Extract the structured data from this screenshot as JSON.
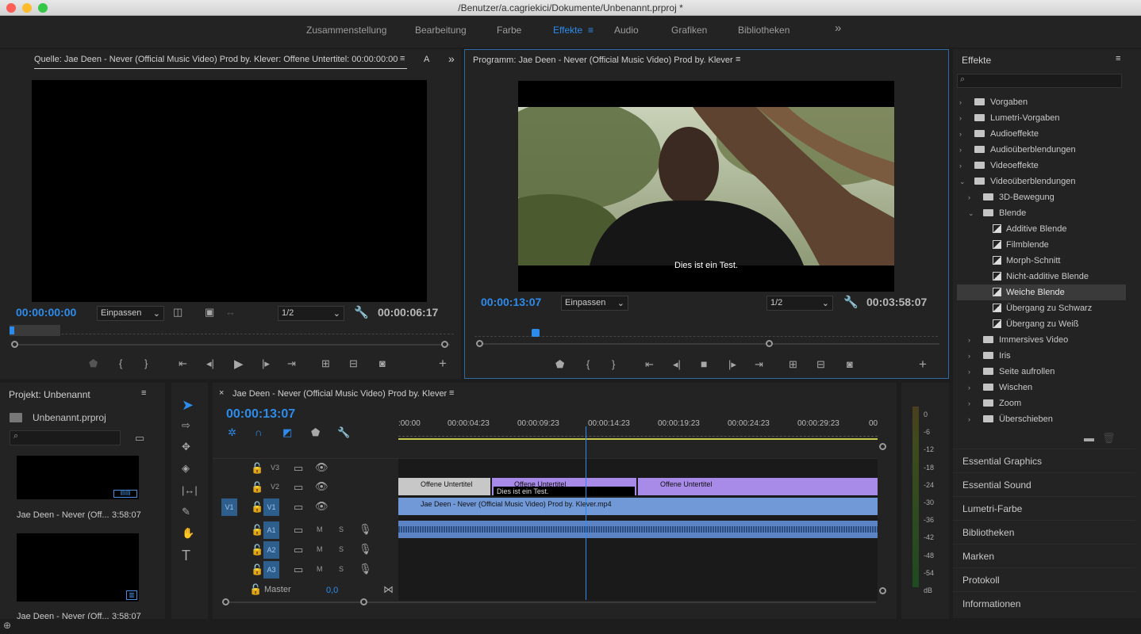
{
  "window": {
    "title": "/Benutzer/a.cagriekici/Dokumente/Unbenannt.prproj *"
  },
  "workspaces": {
    "items": [
      "Zusammenstellung",
      "Bearbeitung",
      "Farbe",
      "Effekte",
      "Audio",
      "Grafiken",
      "Bibliotheken"
    ],
    "active": "Effekte",
    "overflow": "»"
  },
  "source": {
    "title": "Quelle: Jae Deen - Never (Official Music Video) Prod by. Klever: Offene Untertitel: 00:00:00:00",
    "menu": "≡",
    "tab2": "A",
    "timecode": "00:00:00:00",
    "fit": "Einpassen",
    "res": "1/2",
    "duration": "00:00:06:17"
  },
  "program": {
    "title": "Programm: Jae Deen - Never (Official Music Video) Prod by. Klever",
    "menu": "≡",
    "timecode": "00:00:13:07",
    "fit": "Einpassen",
    "res": "1/2",
    "duration": "00:03:58:07",
    "subtitle": "Dies ist ein Test."
  },
  "project": {
    "title": "Projekt: Unbenannt",
    "file": "Unbenannt.prproj",
    "clip1_name": "Jae Deen - Never (Off...",
    "clip1_dur": "3:58:07",
    "clip2_name": "Jae Deen - Never (Off...",
    "clip2_dur": "3:58:07"
  },
  "timeline": {
    "title": "Jae Deen - Never (Official Music Video) Prod by. Klever",
    "close": "×",
    "timecode": "00:00:13:07",
    "ruler": [
      ":00:00",
      "00:00:04:23",
      "00:00:09:23",
      "00:00:14:23",
      "00:00:19:23",
      "00:00:24:23",
      "00:00:29:23",
      "00"
    ],
    "tracks": {
      "v3": "V3",
      "v2": "V2",
      "v1": "V1",
      "src_v1": "V1",
      "a1": "A1",
      "a2": "A2",
      "a3": "A3",
      "master": "Master",
      "master_val": "0,0",
      "m": "M",
      "s": "S"
    },
    "caption_label": "Offene Untertitel",
    "caption_tip": "Dies ist ein Test.",
    "video_clip": "Jae Deen - Never (Official Music Video) Prod by. Klever.mp4",
    "playhead_fraction": 0.39
  },
  "effects": {
    "title": "Effekte",
    "menu": "≡",
    "search_placeholder": "",
    "tree": [
      {
        "label": "Vorgaben",
        "level": 0,
        "kind": "preset-folder",
        "open": false
      },
      {
        "label": "Lumetri-Vorgaben",
        "level": 0,
        "kind": "preset-folder",
        "open": false
      },
      {
        "label": "Audioeffekte",
        "level": 0,
        "kind": "folder",
        "open": false
      },
      {
        "label": "Audioüberblendungen",
        "level": 0,
        "kind": "folder",
        "open": false
      },
      {
        "label": "Videoeffekte",
        "level": 0,
        "kind": "folder",
        "open": false
      },
      {
        "label": "Videoüberblendungen",
        "level": 0,
        "kind": "folder",
        "open": true
      },
      {
        "label": "3D-Bewegung",
        "level": 1,
        "kind": "folder",
        "open": false
      },
      {
        "label": "Blende",
        "level": 1,
        "kind": "folder",
        "open": true
      },
      {
        "label": "Additive Blende",
        "level": 2,
        "kind": "effect"
      },
      {
        "label": "Filmblende",
        "level": 2,
        "kind": "effect"
      },
      {
        "label": "Morph-Schnitt",
        "level": 2,
        "kind": "effect"
      },
      {
        "label": "Nicht-additive Blende",
        "level": 2,
        "kind": "effect"
      },
      {
        "label": "Weiche Blende",
        "level": 2,
        "kind": "effect",
        "selected": true
      },
      {
        "label": "Übergang zu Schwarz",
        "level": 2,
        "kind": "effect"
      },
      {
        "label": "Übergang zu Weiß",
        "level": 2,
        "kind": "effect"
      },
      {
        "label": "Immersives Video",
        "level": 1,
        "kind": "folder",
        "open": false
      },
      {
        "label": "Iris",
        "level": 1,
        "kind": "folder",
        "open": false
      },
      {
        "label": "Seite aufrollen",
        "level": 1,
        "kind": "folder",
        "open": false
      },
      {
        "label": "Wischen",
        "level": 1,
        "kind": "folder",
        "open": false
      },
      {
        "label": "Zoom",
        "level": 1,
        "kind": "folder",
        "open": false
      },
      {
        "label": "Überschieben",
        "level": 1,
        "kind": "folder",
        "open": false
      }
    ]
  },
  "side_panels": [
    "Essential Graphics",
    "Essential Sound",
    "Lumetri-Farbe",
    "Bibliotheken",
    "Marken",
    "Protokoll",
    "Informationen"
  ],
  "meter": {
    "scale": [
      "0",
      "-6",
      "-12",
      "-18",
      "-24",
      "-30",
      "-36",
      "-42",
      "-48",
      "-54",
      "dB"
    ]
  },
  "colors": {
    "accent": "#2d8ceb",
    "caption_clip": "#a88be8",
    "video_clip": "#7199d8",
    "audio_clip": "#5c84c4",
    "track_target": "#2e5f8c"
  }
}
